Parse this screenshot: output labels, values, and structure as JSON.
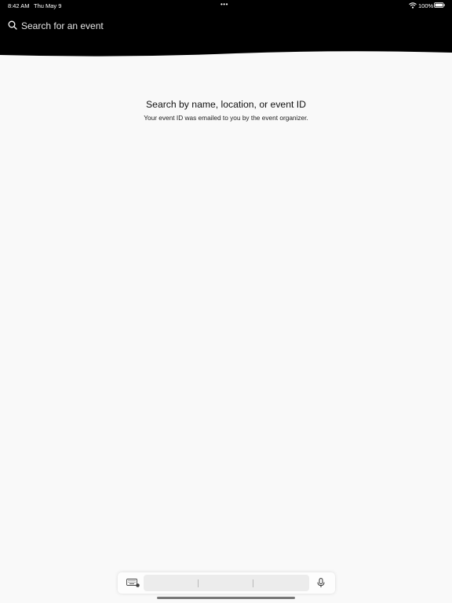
{
  "status_bar": {
    "time": "8:42 AM",
    "date": "Thu May 9",
    "multitasking_dots": "•••",
    "battery_percent": "100%",
    "wifi_icon": "wifi-icon",
    "battery_icon": "battery-full-icon"
  },
  "header": {
    "background_color": "#000000",
    "search": {
      "placeholder": "Search for an event",
      "value": "",
      "icon": "search-icon"
    }
  },
  "empty_state": {
    "title": "Search by name, location, or event ID",
    "subtitle": "Your event ID was emailed to you by the event organizer."
  },
  "keyboard_shortcut_bar": {
    "keyboard_icon": "keyboard-icon",
    "predictions": [
      "",
      "",
      ""
    ],
    "mic_icon": "microphone-icon"
  },
  "colors": {
    "background": "#f9f9f9",
    "header": "#000000",
    "text": "#111111"
  }
}
